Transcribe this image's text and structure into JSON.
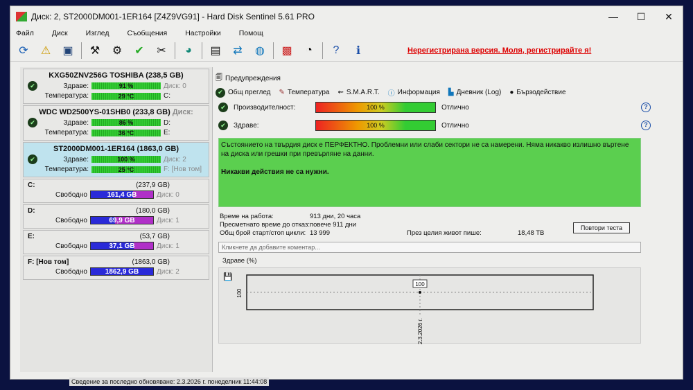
{
  "window": {
    "title": "Диск: 2, ST2000DM001-1ER164 [Z4Z9VG91]  -  Hard Disk Sentinel 5.61 PRO",
    "minimize": "—",
    "maximize": "☐",
    "close": "✕"
  },
  "menu": [
    "Файл",
    "Диск",
    "Изглед",
    "Съобщения",
    "Настройки",
    "Помощ"
  ],
  "toolbar": {
    "registration": "Нерегистрирана версия. Моля, регистрирайте я!"
  },
  "disks": [
    {
      "name": "KXG50ZNV256G TOSHIBA (238,5 GB)",
      "health_label": "Здраве:",
      "health": "91 %",
      "temp_label": "Температура:",
      "temp": "29 °C",
      "disk": "Диск: 0",
      "vol": "C:"
    },
    {
      "name": "WDC WD2500YS-01SHB0 (233,8 GB)",
      "health_label": "Здраве:",
      "health": "86 %",
      "temp_label": "Температура:",
      "temp": "36 °C",
      "disk": "Диск:",
      "vol": "D:",
      "vol2": "E:"
    },
    {
      "name": "ST2000DM001-1ER164 (1863,0 GB)",
      "health_label": "Здраве:",
      "health": "100 %",
      "temp_label": "Температура:",
      "temp": "25 °C",
      "disk": "Диск: 2",
      "vol": "F: [Нов том]"
    }
  ],
  "volumes": [
    {
      "name": "C:",
      "size": "(237,9 GB)",
      "free_label": "Свободно",
      "free": "161,4 GB",
      "disk": "Диск: 0",
      "free_pct": 68
    },
    {
      "name": "D:",
      "size": "(180,0 GB)",
      "free_label": "Свободно",
      "free": "69,9 GB",
      "disk": "Диск: 1",
      "free_pct": 39
    },
    {
      "name": "E:",
      "size": "(53,7 GB)",
      "free_label": "Свободно",
      "free": "37,1 GB",
      "disk": "Диск: 1",
      "free_pct": 69
    },
    {
      "name": "F: [Нов том]",
      "size": "(1863,0 GB)",
      "free_label": "Свободно",
      "free": "1862,9 GB",
      "disk": "Диск: 2",
      "free_pct": 100
    }
  ],
  "main": {
    "warnings": "Предупреждения",
    "tabs": [
      "Общ преглед",
      "Температура",
      "S.M.A.R.T.",
      "Информация",
      "Дневник (Log)",
      "Бързодействие"
    ],
    "performance_label": "Производителност:",
    "performance": "100 %",
    "performance_status": "Отлично",
    "health_label": "Здраве:",
    "health": "100 %",
    "health_status": "Отлично",
    "status_text": "Състоянието на твърдия диск е ПЕРФЕКТНО. Проблемни или слаби сектори не са намерени. Няма никакво излишно въртене на диска или грешки при превърляне на данни.",
    "action_text": "Никакви действия не са нужни.",
    "uptime_label": "Време на работа:",
    "uptime": "913 дни, 20 часа",
    "lifetime_label": "Пресметнато време до отказ:",
    "lifetime": "повече 911 дни",
    "cycles_label": "Общ брой старт/стоп цикли:",
    "cycles": "13 999",
    "written_label": "През целия живот пише:",
    "written": "18,48 TB",
    "retest": "Повтори теста",
    "comment_placeholder": "Кликнете да добавите коментар...",
    "chart_tab": "Здраве (%)"
  },
  "chart_data": {
    "type": "line",
    "title": "Здраве (%)",
    "x": [
      "2.3.2026 г."
    ],
    "values": [
      100
    ],
    "ylabel": "",
    "yticks": [
      "100"
    ],
    "data_labels": [
      "100"
    ]
  },
  "statusbar": "Сведение за последно обновяване: 2.3.2026 г. понеделник 11:44:08"
}
